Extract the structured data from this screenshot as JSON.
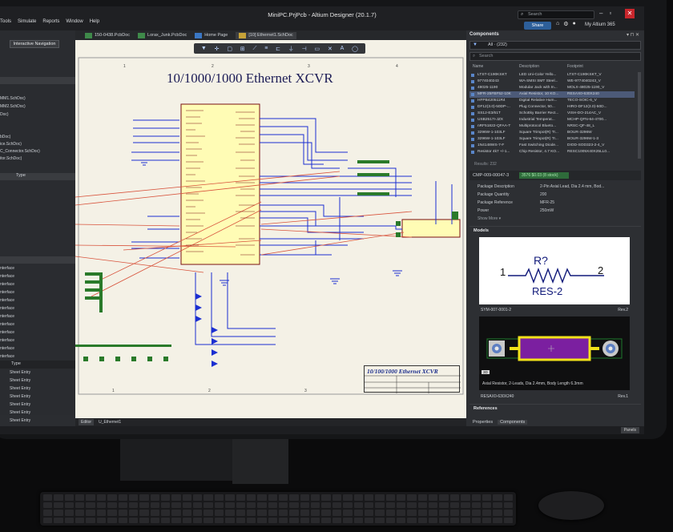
{
  "window": {
    "title": "MiniPC.PrjPcb - Altium Designer (20.1.7)",
    "search_placeholder": "Search",
    "share_label": "Share",
    "account_label": "My Altium 365"
  },
  "menu": [
    "Tools",
    "Simulate",
    "Reports",
    "Window",
    "Help"
  ],
  "doc_tabs": [
    "150-0438.PcbDoc",
    "Lorax_Junk.PcbDoc",
    "Home Page",
    "[10] Ethernet1.SchDoc"
  ],
  "left_panel": {
    "nav_button": "Interactive Navigation",
    "files": [
      "MM1.SchDoc)",
      "MM2.SchDoc)",
      "Doc)",
      "bDoc)",
      "ice.SchDoc)",
      "C_Connector.SchDoc)",
      "itor.SchDoc)"
    ],
    "type_header_1": "Type",
    "interfaces": [
      "nterface",
      "nterface",
      "nterface",
      "nterface",
      "nterface",
      "nterface",
      "nterface",
      "nterface",
      "nterface",
      "nterface",
      "nterface",
      "nterface"
    ],
    "type_header_2": "Type",
    "sheet_entries": [
      "Sheet Entry",
      "Sheet Entry",
      "Sheet Entry",
      "Sheet Entry",
      "Sheet Entry",
      "Sheet Entry",
      "Sheet Entry"
    ]
  },
  "schematic": {
    "title": "10/1000/1000 Ethernet XCVR",
    "title_block_title": "10/100/1000 Ethernet XCVR",
    "grid_numbers_top": [
      "1",
      "2",
      "3",
      "4"
    ],
    "grid_numbers_bottom": [
      "1",
      "2",
      "3",
      "4"
    ]
  },
  "bottom_tabs": [
    "Editor",
    "U_Ethernet1"
  ],
  "status_bar": {
    "panels_button": "Panels"
  },
  "components_panel": {
    "title": "Components",
    "filter_value": "All · (232)",
    "search_placeholder": "Search",
    "columns": [
      "Name",
      "Description",
      "Footprint"
    ],
    "rows": [
      {
        "name": "LTST-C190KSKT",
        "desc": "LED Uni-Color Yello...",
        "fp": "LTST-C190KSKT_V"
      },
      {
        "name": "9774040243",
        "desc": "WA-SMSI SMT Steel...",
        "fp": "WE-9774040243_V"
      },
      {
        "name": "48025-1190",
        "desc": "Modular Jack with In...",
        "fp": "MOLX-48025-1190_V"
      },
      {
        "name": "MFR-25FBF52-10K",
        "desc": "Axial Resistor, 10 KO...",
        "fp": "RESAX0-630X240"
      },
      {
        "name": "HFPB420511R4",
        "desc": "Digital Relative Hum...",
        "fp": "TECO-SOIC-6_V"
      },
      {
        "name": "DF12(3.0)-50DP-...",
        "desc": "Plug Connector, 50...",
        "fp": "HIRO-DF12(3.0)-50D..."
      },
      {
        "name": "SS12-E3/61T",
        "desc": "Schottky Barrier Rect...",
        "fp": "VISH-DO-214AC_V"
      },
      {
        "name": "USB2517I-JZX",
        "desc": "Industrial Temperat...",
        "fp": "MCHP-QFN-64-4700..."
      },
      {
        "name": "nRF51822-QFAA-T",
        "desc": "Multiprotocol Blueto...",
        "fp": "NRSC-QF-48_L"
      },
      {
        "name": "3296W-1-103LF",
        "desc": "Square Trimpot(R) Tr...",
        "fp": "BOUR-3296W"
      },
      {
        "name": "3296W-1-103LF",
        "desc": "Square Trimpot(R) Tr...",
        "fp": "BOUR-3296W-1-3"
      },
      {
        "name": "1N4148WS-7-F",
        "desc": "Fast Switching Diode...",
        "fp": "DIOD-SOD323-2-4_V"
      },
      {
        "name": "Resistor 4k7 +/-1...",
        "desc": "Chip Resistor, 4.7 KO...",
        "fp": "RESC1005X40X25LL0..."
      }
    ],
    "results": "Results: 232",
    "part_id": "CMP-009-00047-3",
    "stock": "3576  $0.03 (8 stock)",
    "properties": [
      {
        "k": "Package Description",
        "v": "2-Pin Axial Lead, Dia 2.4 mm, Bod..."
      },
      {
        "k": "Package Quantity",
        "v": "200"
      },
      {
        "k": "Package Reference",
        "v": "MFR-25"
      },
      {
        "k": "Power",
        "v": "250mW"
      }
    ],
    "show_more": "Show More ▾",
    "models_header": "Models",
    "symbol": {
      "designator": "R?",
      "pin1": "1",
      "pin2": "2",
      "name": "RES-2"
    },
    "symbol_id": "SYM-007-0001-2",
    "symbol_rev": "Rev.2",
    "footprint_desc": "Axial Resistor, 2-Leads, Dia 2.4mm, Body Length 6.3mm",
    "footprint_id": "RESAX0-630X240",
    "footprint_rev": "Rev.1",
    "badge_3d": "3D",
    "references_header": "References",
    "tabs": [
      "Properties",
      "Components"
    ]
  },
  "colors": {
    "accent": "#2d5f9a",
    "selected_row": "#4c5a78",
    "schematic_bg": "#f4f1e6",
    "ic_body": "#fffcb5",
    "wire_blue": "#1b2fd1",
    "wire_red": "#d8533c",
    "close_red": "#c8262c",
    "stock_green": "#2e6b3a",
    "footprint_body": "#7b1fa0",
    "footprint_outline": "#f2e21a"
  }
}
